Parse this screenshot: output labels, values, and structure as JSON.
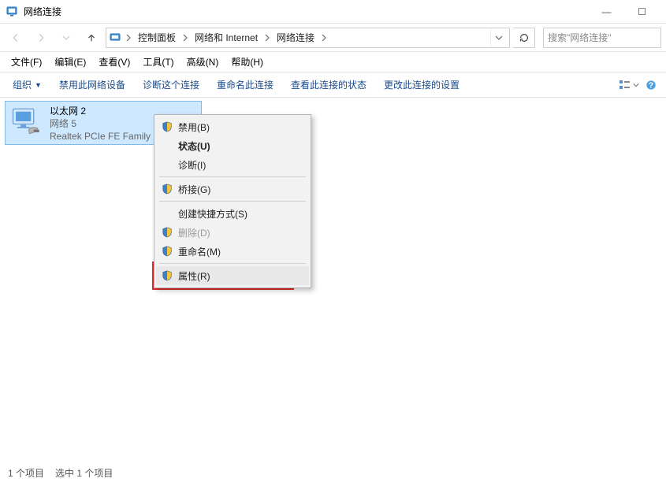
{
  "window": {
    "title": "网络连接",
    "minimize": "—",
    "maximize": "☐"
  },
  "breadcrumbs": {
    "items": [
      "控制面板",
      "网络和 Internet",
      "网络连接"
    ]
  },
  "search": {
    "placeholder": "搜索\"网络连接\""
  },
  "menubar": {
    "items": [
      "文件(F)",
      "编辑(E)",
      "查看(V)",
      "工具(T)",
      "高级(N)",
      "帮助(H)"
    ]
  },
  "toolbar": {
    "organize": "组织",
    "actions": [
      "禁用此网络设备",
      "诊断这个连接",
      "重命名此连接",
      "查看此连接的状态",
      "更改此连接的设置"
    ]
  },
  "connection": {
    "name": "以太网 2",
    "status": "网络  5",
    "device": "Realtek PCIe FE Family"
  },
  "context_menu": {
    "items": [
      {
        "label": "禁用(B)",
        "shield": true,
        "disabled": false,
        "bold": false
      },
      {
        "label": "状态(U)",
        "shield": false,
        "disabled": false,
        "bold": true
      },
      {
        "label": "诊断(I)",
        "shield": false,
        "disabled": false,
        "bold": false
      },
      {
        "sep": true
      },
      {
        "label": "桥接(G)",
        "shield": true,
        "disabled": false,
        "bold": false
      },
      {
        "sep": true
      },
      {
        "label": "创建快捷方式(S)",
        "shield": false,
        "disabled": false,
        "bold": false
      },
      {
        "label": "删除(D)",
        "shield": true,
        "disabled": true,
        "bold": false
      },
      {
        "label": "重命名(M)",
        "shield": true,
        "disabled": false,
        "bold": false
      },
      {
        "sep": true
      },
      {
        "label": "属性(R)",
        "shield": true,
        "disabled": false,
        "bold": false,
        "highlight": true
      }
    ]
  },
  "statusbar": {
    "left": "1 个项目",
    "right": "选中 1 个项目"
  }
}
